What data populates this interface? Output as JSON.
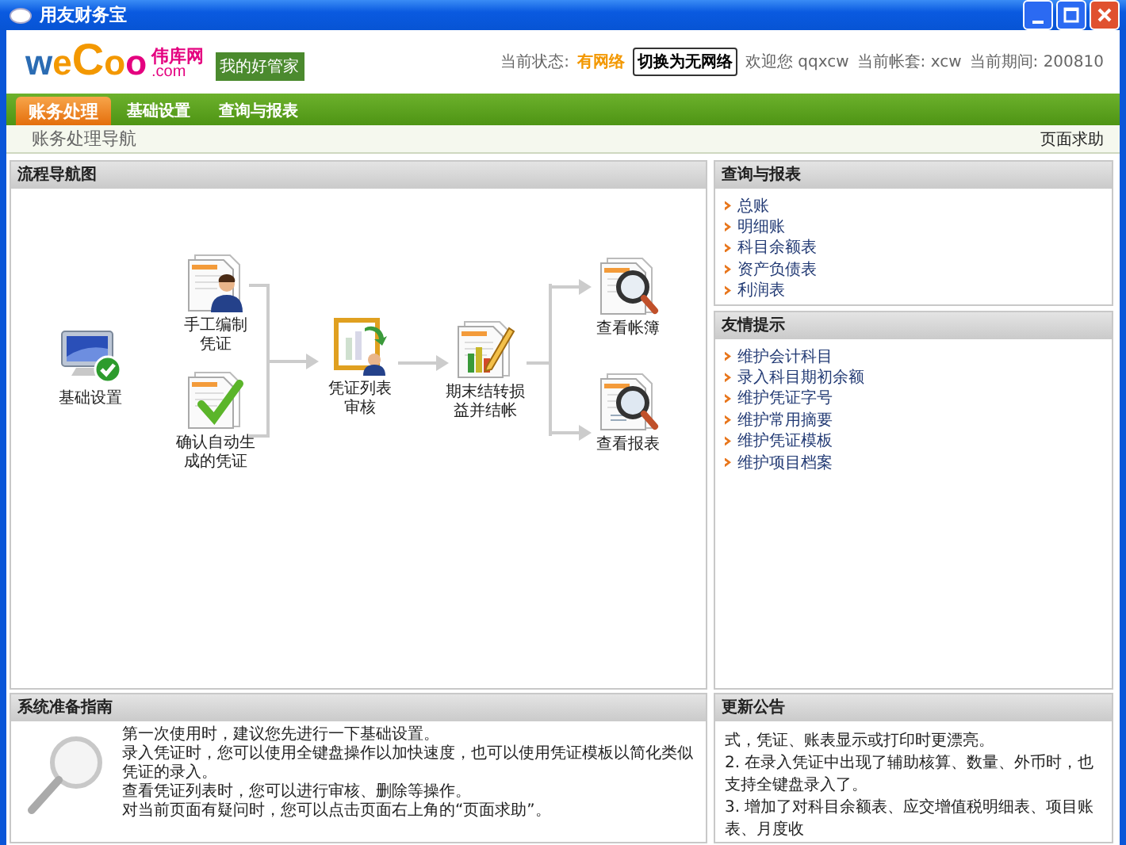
{
  "window": {
    "title": "用友财务宝"
  },
  "header": {
    "logo": {
      "brand": "weCoo",
      "site": "伟库网",
      "domain": ".com"
    },
    "slogan": "我的好管家",
    "status_label": "当前状态:",
    "status_value": "有网络",
    "switch_button": "切换为无网络",
    "welcome": "欢迎您 qqxcw",
    "account": "当前帐套: xcw",
    "period": "当前期间: 200810"
  },
  "tabs": [
    {
      "label": "账务处理",
      "selected": true
    },
    {
      "label": "基础设置",
      "selected": false
    },
    {
      "label": "查询与报表",
      "selected": false
    }
  ],
  "breadcrumb": {
    "title": "账务处理导航",
    "help_link": "页面求助"
  },
  "flow": {
    "title": "流程导航图",
    "nodes": [
      {
        "kind": "setup",
        "label": "基础设置"
      },
      {
        "kind": "manual",
        "label": "手工编制凭证"
      },
      {
        "kind": "auto",
        "label": "确认自动生成的凭证"
      },
      {
        "kind": "review",
        "label": "凭证列表审核"
      },
      {
        "kind": "closing",
        "label": "期末结转损益并结帐"
      },
      {
        "kind": "ledger",
        "label": "查看帐簿"
      },
      {
        "kind": "report",
        "label": "查看报表"
      }
    ]
  },
  "query_panel": {
    "title": "查询与报表",
    "links": [
      "总账",
      "明细账",
      "科目余额表",
      "资产负债表",
      "利润表"
    ]
  },
  "tips_panel": {
    "title": "友情提示",
    "links": [
      "维护会计科目",
      "录入科目期初余额",
      "维护凭证字号",
      "维护常用摘要",
      "维护凭证模板",
      "维护项目档案"
    ]
  },
  "guide": {
    "title": "系统准备指南",
    "lines": [
      "第一次使用时，建议您先进行一下基础设置。",
      "录入凭证时，您可以使用全键盘操作以加快速度，也可以使用凭证模板以简化类似凭证的录入。",
      "查看凭证列表时，您可以进行审核、删除等操作。",
      "对当前页面有疑问时，您可以点击页面右上角的“页面求助”。"
    ]
  },
  "news": {
    "title": "更新公告",
    "lines": [
      "式，凭证、账表显示或打印时更漂亮。",
      "2. 在录入凭证中出现了辅助核算、数量、外币时，也支持全键盘录入了。",
      "3. 增加了对科目余额表、应交增值税明细表、项目账表、月度收"
    ]
  }
}
